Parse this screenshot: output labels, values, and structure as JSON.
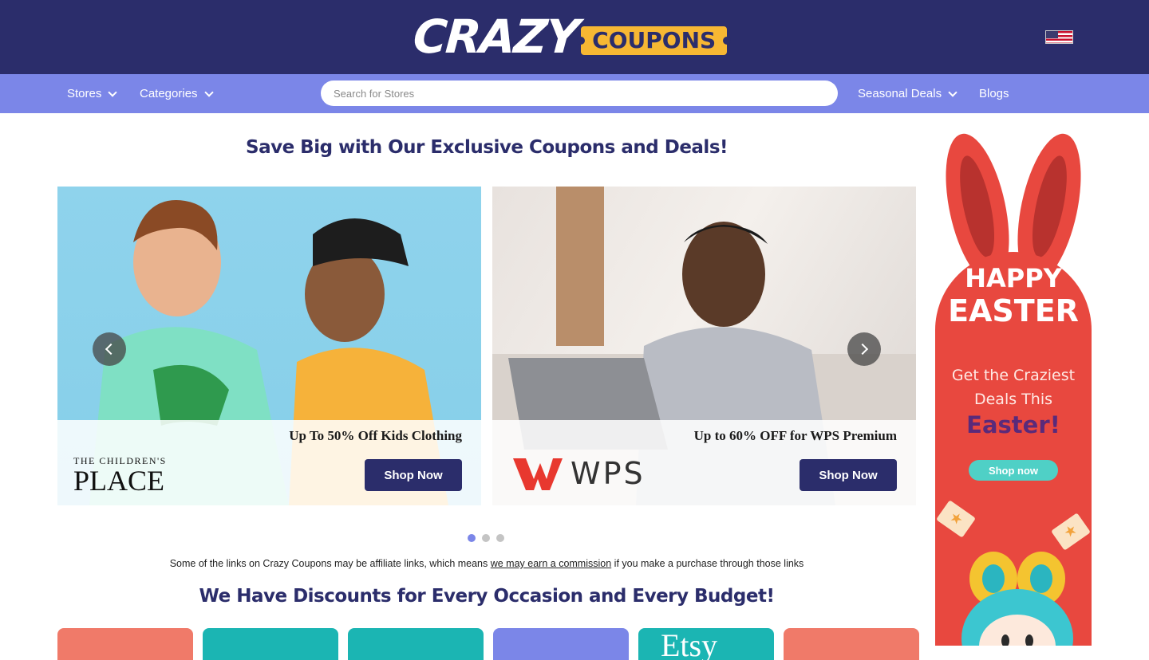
{
  "header": {
    "logo_main": "CRAZY",
    "logo_tag": "COUPONS",
    "flag_icon": "us-flag-icon"
  },
  "nav": {
    "items": [
      {
        "label": "Stores",
        "has_dropdown": true
      },
      {
        "label": "Categories",
        "has_dropdown": true
      },
      {
        "label": "Seasonal Deals",
        "has_dropdown": true
      },
      {
        "label": "Blogs",
        "has_dropdown": false
      }
    ],
    "search_placeholder": "Search for Stores",
    "search_value": ""
  },
  "hero": {
    "title": "Save Big with Our Exclusive Coupons and Deals!",
    "slides": [
      {
        "brand_small": "THE CHILDREN'S",
        "brand_big": "PLACE",
        "deal": "Up To 50% Off Kids Clothing",
        "button": "Shop Now"
      },
      {
        "brand_text": "WPS",
        "deal": "Up to 60% OFF for WPS Premium",
        "button": "Shop Now"
      }
    ],
    "dots": {
      "count": 3,
      "active_index": 0
    }
  },
  "disclaimer": {
    "before": "Some of the links on Crazy Coupons may be affiliate links, which means ",
    "link": "we may earn a commission",
    "after": " if you make a purchase through those links"
  },
  "occasions": {
    "title": "We Have Discounts for Every Occasion and Every Budget!",
    "cards": [
      {
        "color": "#f07a69"
      },
      {
        "color": "#1bb5b3"
      },
      {
        "color": "#1bb5b3"
      },
      {
        "color": "#7b86e8"
      },
      {
        "color": "#1bb5b3",
        "label": "Etsy"
      },
      {
        "color": "#f07a69"
      }
    ]
  },
  "ad": {
    "line1": "HAPPY",
    "line2": "EASTER",
    "sub": "Get the Craziest Deals This",
    "emphasis": "Easter!",
    "button": "Shop now"
  },
  "colors": {
    "header_bg": "#2b2d6b",
    "nav_bg": "#7b86e8",
    "accent_yellow": "#f7b733",
    "button_bg": "#2b2d6b",
    "ad_red": "#e8483f",
    "ad_teal": "#4fd0c6"
  }
}
